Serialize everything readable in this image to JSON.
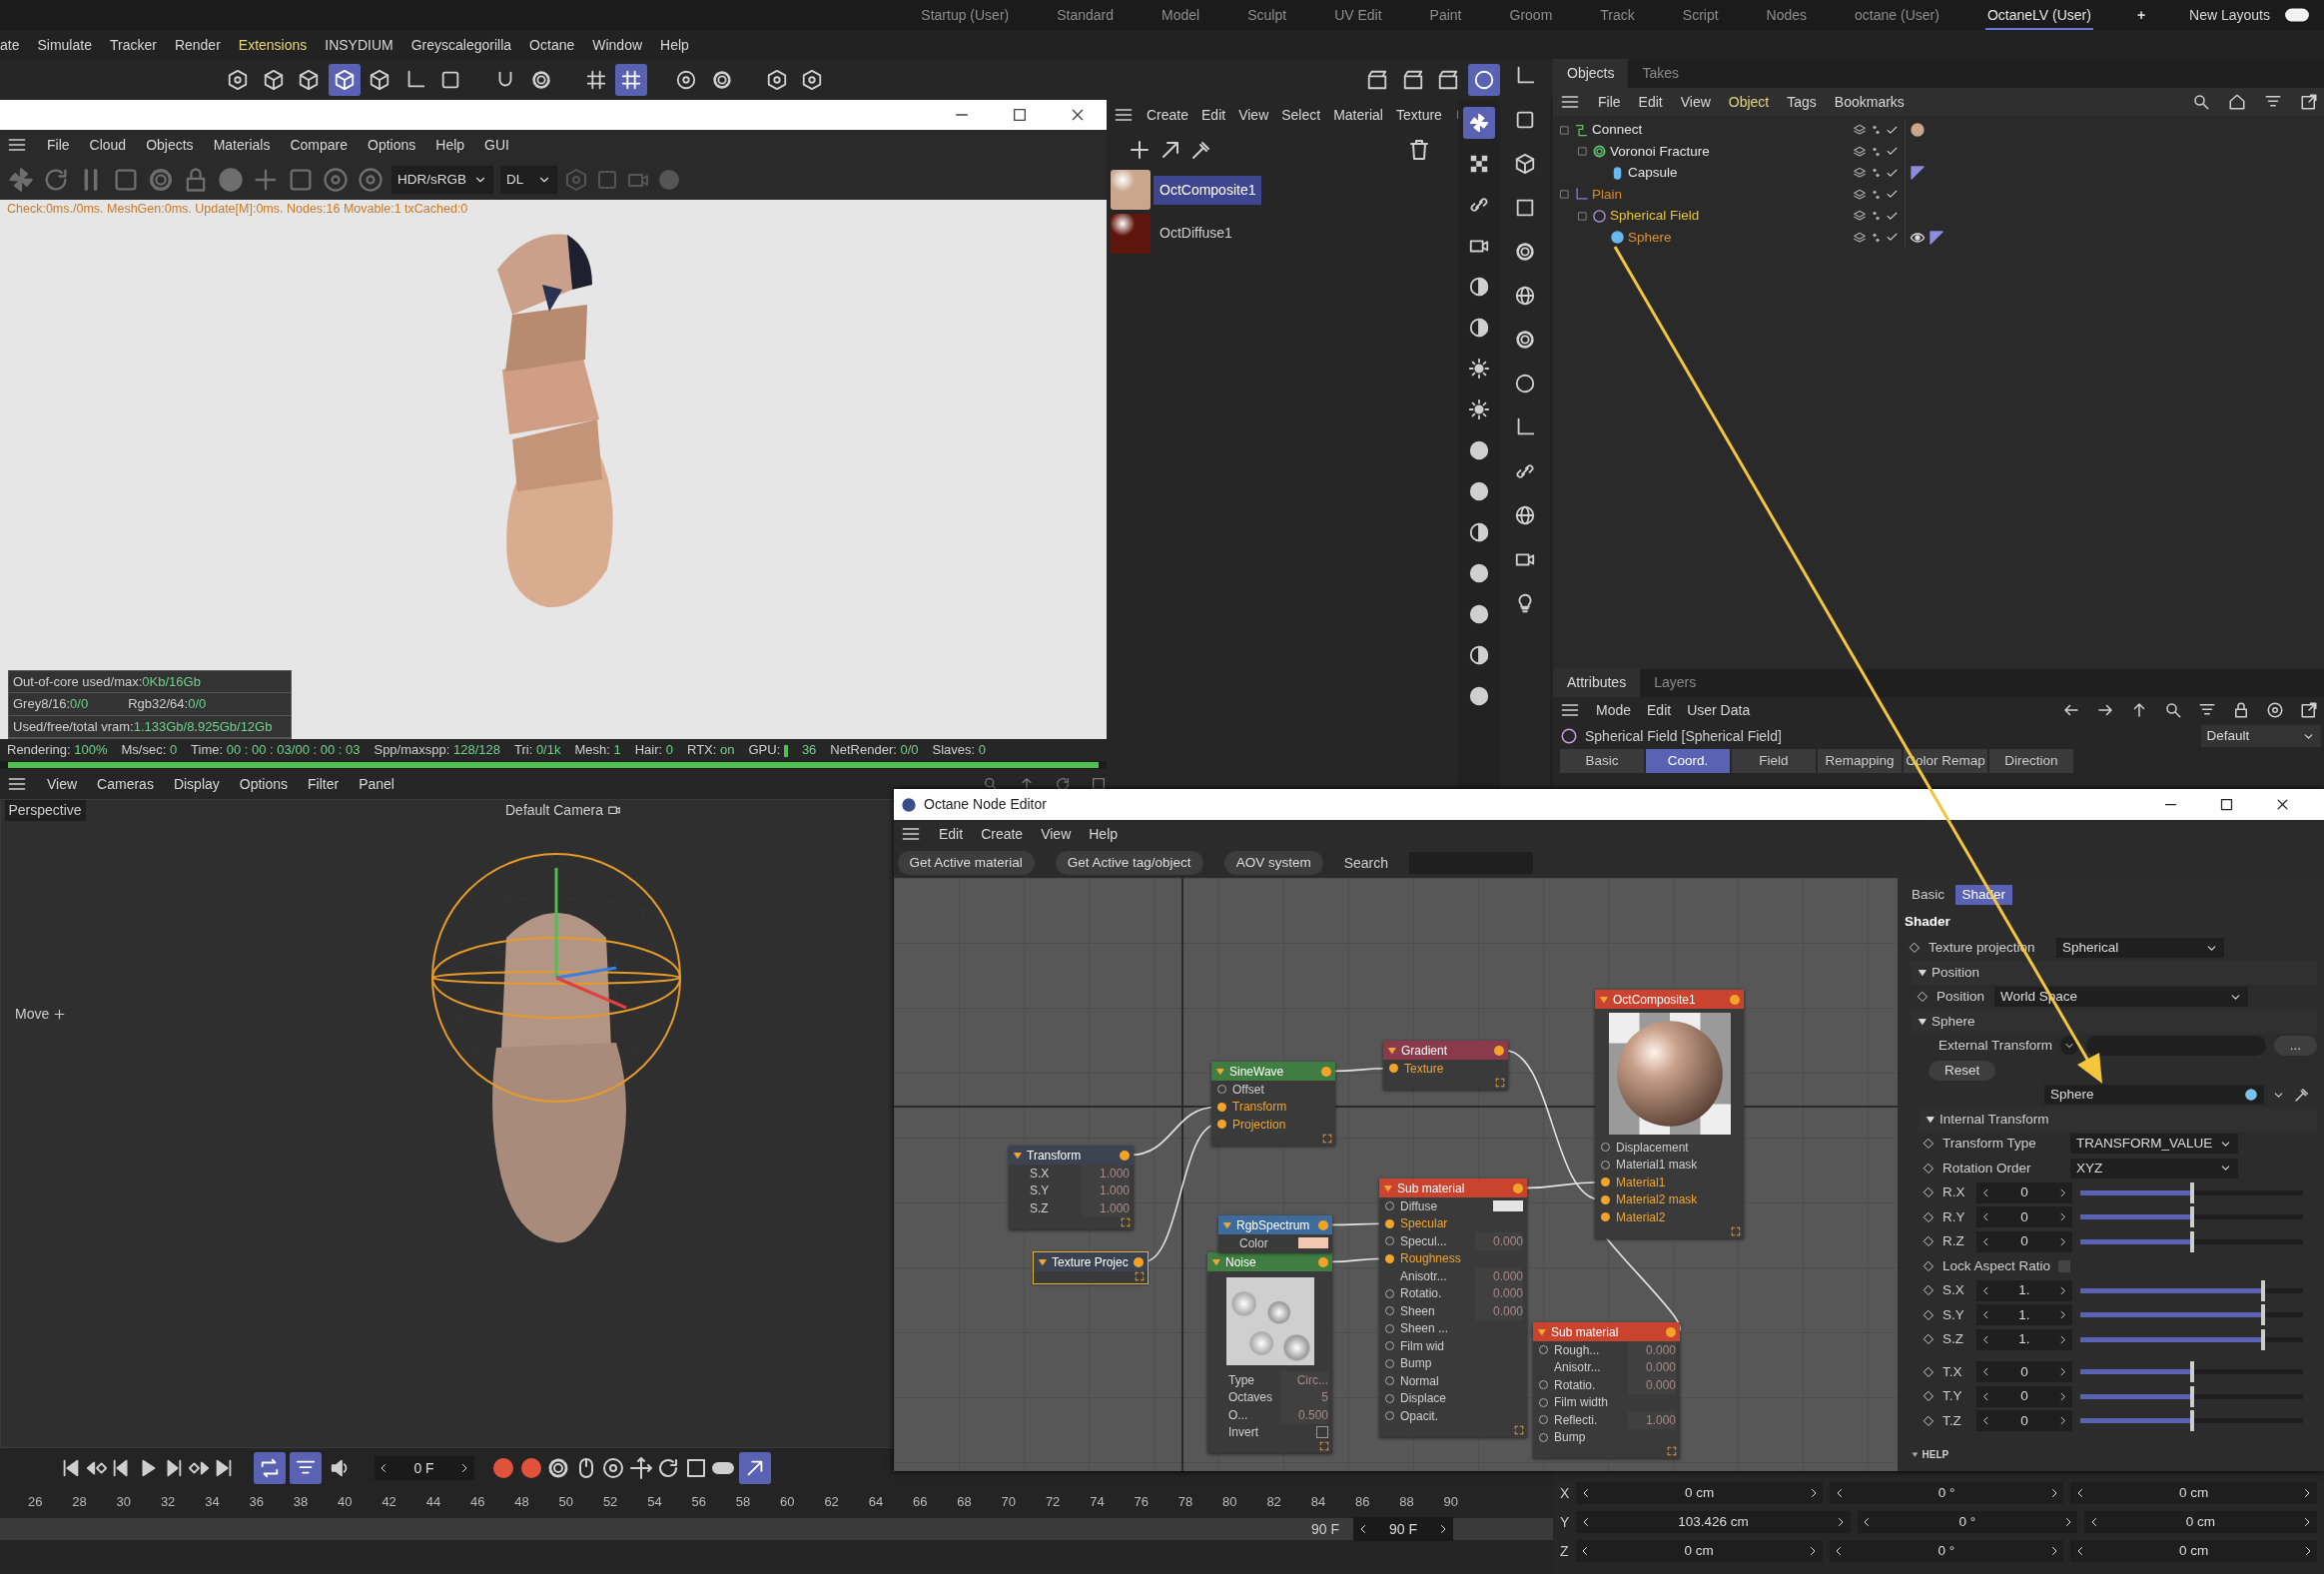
{
  "layout_tabs": [
    {
      "label": "Startup (User)",
      "selected": false
    },
    {
      "label": "Standard",
      "selected": false
    },
    {
      "label": "Model",
      "selected": false
    },
    {
      "label": "Sculpt",
      "selected": false
    },
    {
      "label": "UV Edit",
      "selected": false
    },
    {
      "label": "Paint",
      "selected": false
    },
    {
      "label": "Groom",
      "selected": false
    },
    {
      "label": "Track",
      "selected": false
    },
    {
      "label": "Script",
      "selected": false
    },
    {
      "label": "Nodes",
      "selected": false
    },
    {
      "label": "octane (User)",
      "selected": false
    },
    {
      "label": "OctaneLV (User)",
      "selected": true
    }
  ],
  "add_layout": "+",
  "new_layouts": {
    "label": "New Layouts",
    "on": true
  },
  "main_menu": [
    {
      "label": "ate",
      "highlighted": false
    },
    {
      "label": "Simulate",
      "highlighted": false
    },
    {
      "label": "Tracker",
      "highlighted": false
    },
    {
      "label": "Render",
      "highlighted": false
    },
    {
      "label": "Extensions",
      "highlighted": true
    },
    {
      "label": "INSYDIUM",
      "highlighted": false
    },
    {
      "label": "Greyscalegorilla",
      "highlighted": false
    },
    {
      "label": "Octane",
      "highlighted": false
    },
    {
      "label": "Window",
      "highlighted": false
    },
    {
      "label": "Help",
      "highlighted": false
    }
  ],
  "render_window": {
    "menu": [
      "File",
      "Cloud",
      "Objects",
      "Materials",
      "Compare",
      "Options",
      "Help",
      "GUI"
    ],
    "color_space": "HDR/sRGB",
    "render_mode": "DL",
    "check_line": "Check:0ms./0ms. MeshGen:0ms. Update[M]:0ms. Nodes:16 Movable:1 txCached:0",
    "memory": [
      {
        "cells": [
          {
            "label": "Out-of-core used/max:",
            "value": "0Kb/16Gb"
          }
        ]
      },
      {
        "cells": [
          {
            "label": "Grey8/16:",
            "value": "0/0"
          },
          {
            "label": "Rgb32/64:",
            "value": "0/0"
          }
        ]
      },
      {
        "cells": [
          {
            "label": "Used/free/total vram:",
            "value": "1.133Gb/8.925Gb/12Gb"
          }
        ]
      }
    ],
    "status": [
      {
        "label": "Rendering:",
        "value": "100%",
        "kind": "text"
      },
      {
        "label": "Ms/sec:",
        "value": "0",
        "kind": "text"
      },
      {
        "label": "Time:",
        "value": "00 : 00 : 03/00 : 00 : 03",
        "kind": "text"
      },
      {
        "label": "Spp/maxspp:",
        "value": "128/128",
        "kind": "text"
      },
      {
        "label": "Tri:",
        "value": "0/1k",
        "kind": "text"
      },
      {
        "label": "Mesh:",
        "value": "1",
        "kind": "text"
      },
      {
        "label": "Hair:",
        "value": "0",
        "kind": "text"
      },
      {
        "label": "RTX:",
        "value": "on",
        "kind": "text"
      },
      {
        "label": "GPU:",
        "value": "36",
        "kind": "meter"
      },
      {
        "label": "NetRender:",
        "value": "0/0",
        "kind": "text"
      },
      {
        "label": "Slaves:",
        "value": "0",
        "kind": "text"
      }
    ],
    "progress": {
      "level": 1
    }
  },
  "viewport": {
    "menu": [
      "View",
      "Cameras",
      "Display",
      "Options",
      "Filter",
      "Panel"
    ],
    "view": "Perspective",
    "camera": "Default Camera",
    "tool": "Move"
  },
  "timeline": {
    "current_frame": "0 F",
    "ruler": [
      "26",
      "28",
      "30",
      "32",
      "34",
      "36",
      "38",
      "40",
      "42",
      "44",
      "46",
      "48",
      "50",
      "52",
      "54",
      "56",
      "58",
      "60",
      "62",
      "64",
      "66",
      "68",
      "70",
      "72",
      "74",
      "76",
      "78",
      "80",
      "82",
      "84",
      "86",
      "88",
      "90"
    ],
    "end_frame": "90 F",
    "max_frame": "90 F"
  },
  "material_manager": {
    "menu": [
      "Create",
      "Edit",
      "View",
      "Select",
      "Material",
      "Texture"
    ],
    "materials": [
      {
        "name": "OctComposite1",
        "selected": true,
        "color": "#c9a68c"
      },
      {
        "name": "OctDiffuse1",
        "selected": false,
        "color": "#5e160c"
      }
    ]
  },
  "objects_panel": {
    "tabs": [
      {
        "label": "Objects",
        "selected": true
      },
      {
        "label": "Takes",
        "selected": false
      }
    ],
    "menu": [
      {
        "label": "File",
        "highlighted": false
      },
      {
        "label": "Edit",
        "highlighted": false
      },
      {
        "label": "View",
        "highlighted": false
      },
      {
        "label": "Object",
        "highlighted": true
      },
      {
        "label": "Tags",
        "highlighted": false
      },
      {
        "label": "Bookmarks",
        "highlighted": false
      }
    ],
    "tree": [
      {
        "name": "Connect",
        "kind": "connect",
        "color": "#e6e6e6",
        "material_tag": true,
        "children": [
          {
            "name": "Voronoi Fracture",
            "kind": "fracture",
            "color": "#e6e6e6",
            "children": [
              {
                "name": "Capsule",
                "kind": "capsule",
                "color": "#e6e6e6",
                "texture_tag": true
              }
            ]
          }
        ]
      },
      {
        "name": "Plain",
        "kind": "plain",
        "color": "#d98a2c",
        "children": [
          {
            "name": "Spherical Field",
            "kind": "field",
            "color": "#ecc437",
            "children": [
              {
                "name": "Sphere",
                "kind": "sphere",
                "color": "#e0922f",
                "visible_tag": true,
                "texture_tag": true
              }
            ]
          }
        ]
      }
    ]
  },
  "attributes_panel": {
    "tabs": [
      {
        "label": "Attributes",
        "selected": true
      },
      {
        "label": "Layers",
        "selected": false
      }
    ],
    "menu": [
      "Mode",
      "Edit",
      "User Data"
    ],
    "object_title": "Spherical Field [Spherical Field]",
    "preset": "Default",
    "section_tabs": [
      {
        "label": "Basic",
        "selected": false
      },
      {
        "label": "Coord.",
        "selected": true
      },
      {
        "label": "Field",
        "selected": false
      },
      {
        "label": "Remapping",
        "selected": false
      },
      {
        "label": "Color Remap",
        "selected": false
      },
      {
        "label": "Direction",
        "selected": false
      }
    ]
  },
  "node_editor": {
    "title": "Octane Node Editor",
    "menu": [
      "Edit",
      "Create",
      "View",
      "Help"
    ],
    "buttons": [
      "Get Active material",
      "Get Active tag/object",
      "AOV system"
    ],
    "search_label": "Search",
    "nodes": [
      {
        "title": "OctComposite1",
        "color": "#c9432f",
        "selected": false,
        "kind": "material",
        "ports": [
          {
            "kind": "socket",
            "label": "Displacement",
            "linked": false
          },
          {
            "kind": "socket",
            "label": "Material1 mask",
            "linked": false
          },
          {
            "kind": "socket",
            "label": "Material1",
            "linked": true
          },
          {
            "kind": "socket",
            "label": "Material2 mask",
            "linked": true
          },
          {
            "kind": "socket",
            "label": "Material2",
            "linked": true
          }
        ]
      },
      {
        "title": "Gradient",
        "color": "#8b3a4c",
        "selected": false,
        "ports": [
          {
            "kind": "socket",
            "label": "Texture",
            "linked": true
          }
        ]
      },
      {
        "title": "SineWave",
        "color": "#3f7d42",
        "selected": false,
        "ports": [
          {
            "kind": "socket",
            "label": "Offset",
            "linked": false
          },
          {
            "kind": "socket",
            "label": "Transform",
            "linked": true
          },
          {
            "kind": "socket",
            "label": "Projection",
            "linked": true
          }
        ]
      },
      {
        "title": "Transform",
        "color": "#3b4250",
        "selected": false,
        "ports": [
          {
            "kind": "value",
            "label": "S.X",
            "value": "1.000"
          },
          {
            "kind": "value",
            "label": "S.Y",
            "value": "1.000"
          },
          {
            "kind": "value",
            "label": "S.Z",
            "value": "1.000"
          }
        ]
      },
      {
        "title": "Sub material",
        "color": "#c9432f",
        "selected": false,
        "ports": [
          {
            "kind": "swatch",
            "label": "Diffuse",
            "linked": false,
            "color": "#e4e4e4"
          },
          {
            "kind": "socket",
            "label": "Specular",
            "linked": true
          },
          {
            "kind": "socket_value",
            "label": "Specul...",
            "linked": false,
            "value": "0.000"
          },
          {
            "kind": "socket",
            "label": "Roughness",
            "linked": true
          },
          {
            "kind": "value",
            "label": "Anisotr...",
            "value": "0.000"
          },
          {
            "kind": "socket_value",
            "label": "Rotatio.",
            "linked": false,
            "value": "0.000"
          },
          {
            "kind": "socket_value",
            "label": "Sheen",
            "linked": false,
            "value": "0.000"
          },
          {
            "kind": "socket",
            "label": "Sheen ...",
            "linked": false
          },
          {
            "kind": "socket",
            "label": "Film wid",
            "linked": false
          },
          {
            "kind": "socket",
            "label": "Bump",
            "linked": false
          },
          {
            "kind": "socket",
            "label": "Normal",
            "linked": false
          },
          {
            "kind": "socket",
            "label": "Displace",
            "linked": false
          },
          {
            "kind": "socket",
            "label": "Opacit.",
            "linked": false
          }
        ]
      },
      {
        "title": "RgbSpectrum",
        "color": "#3c6b9c",
        "selected": false,
        "ports": [
          {
            "kind": "swatch",
            "label": "Color",
            "color": "#f2c9b0"
          }
        ]
      },
      {
        "title": "Texture Projec",
        "color": "#3b4250",
        "selected": true
      },
      {
        "title": "Noise",
        "color": "#3f7d42",
        "selected": false,
        "kind": "noise",
        "ports": [
          {
            "kind": "value",
            "label": "Type",
            "value": "Circ..."
          },
          {
            "kind": "value",
            "label": "Octaves",
            "value": "5"
          },
          {
            "kind": "value",
            "label": "O...",
            "value": "0.500"
          },
          {
            "kind": "checkbox",
            "label": "Invert",
            "checked": false
          }
        ]
      },
      {
        "title": "Sub material",
        "color": "#c9432f",
        "selected": false,
        "ports": [
          {
            "kind": "socket_value",
            "label": "Rough...",
            "linked": false,
            "value": "0.000"
          },
          {
            "kind": "value",
            "label": "Anisotr...",
            "value": "0.000"
          },
          {
            "kind": "socket_value",
            "label": "Rotatio.",
            "linked": false,
            "value": "0.000"
          },
          {
            "kind": "socket",
            "label": "Film width",
            "linked": false
          },
          {
            "kind": "socket_value",
            "label": "Reflecti.",
            "linked": false,
            "value": "1.000"
          },
          {
            "kind": "socket",
            "label": "Bump",
            "linked": false
          }
        ]
      }
    ],
    "sidebar": {
      "tabs": [
        {
          "label": "Basic",
          "selected": false
        },
        {
          "label": "Shader",
          "selected": true
        }
      ],
      "heading": "Shader",
      "rows": [
        {
          "kind": "dropdown",
          "label": "Texture projection",
          "value": "Spherical"
        },
        {
          "kind": "group",
          "label": "Position",
          "expanded": true
        },
        {
          "kind": "dropdown",
          "label": "Position",
          "value": "World Space"
        },
        {
          "kind": "group",
          "label": "Sphere",
          "expanded": true
        },
        {
          "kind": "link",
          "label": "External Transform",
          "button": "..."
        },
        {
          "kind": "button",
          "label": "Reset"
        },
        {
          "kind": "object",
          "value": "Sphere"
        },
        {
          "kind": "group",
          "label": "Internal Transform",
          "expanded": true
        },
        {
          "kind": "dropdown",
          "label": "Transform Type",
          "value": "TRANSFORM_VALUE"
        },
        {
          "kind": "dropdown",
          "label": "Rotation Order",
          "value": "XYZ"
        },
        {
          "kind": "slider",
          "label": "R.X",
          "value": "0",
          "level": 0.5
        },
        {
          "kind": "slider",
          "label": "R.Y",
          "value": "0",
          "level": 0.5
        },
        {
          "kind": "slider",
          "label": "R.Z",
          "value": "0",
          "level": 0.5
        },
        {
          "kind": "checkbox",
          "label": "Lock Aspect Ratio",
          "checked": false
        },
        {
          "kind": "slider",
          "label": "S.X",
          "value": "1.",
          "level": 0.82
        },
        {
          "kind": "slider",
          "label": "S.Y",
          "value": "1.",
          "level": 0.82
        },
        {
          "kind": "slider",
          "label": "S.Z",
          "value": "1.",
          "level": 0.82
        },
        {
          "kind": "slider",
          "label": "T.X",
          "value": "0",
          "level": 0.5
        },
        {
          "kind": "slider",
          "label": "T.Y",
          "value": "0",
          "level": 0.5
        },
        {
          "kind": "slider",
          "label": "T.Z",
          "value": "0",
          "level": 0.5
        }
      ],
      "help": "HELP"
    }
  },
  "coordinates": {
    "rows": [
      {
        "axis": "X",
        "values": [
          "0 cm",
          "0 °",
          "0 cm"
        ]
      },
      {
        "axis": "Y",
        "values": [
          "103.426 cm",
          "0 °",
          "0 cm"
        ]
      },
      {
        "axis": "Z",
        "values": [
          "0 cm",
          "0 °",
          "0 cm"
        ]
      }
    ]
  }
}
